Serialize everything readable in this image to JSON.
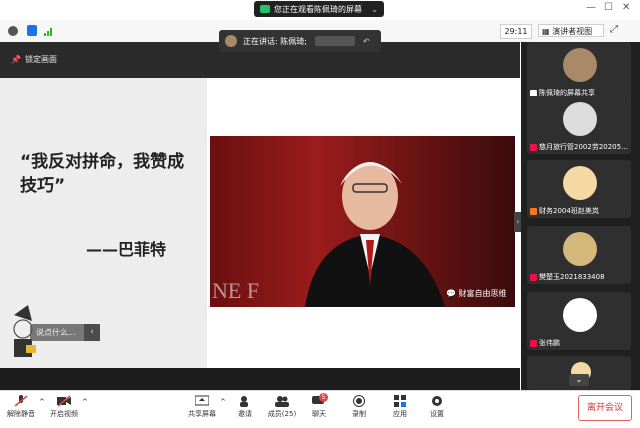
{
  "banner": {
    "text": "您正在观看陈佩琦的屏幕"
  },
  "toolbar": {
    "timer": "29:11",
    "view_label": "演讲者视图"
  },
  "speaker": {
    "label": "正在讲话: 陈佩琦;"
  },
  "stage": {
    "lock_label": "锁定画面",
    "quote": "“我反对拼命，我赞成技巧”",
    "author": "——巴菲特",
    "watermark": "财富自由思维",
    "photo_letters": "NE F",
    "chat_placeholder": "说点什么..."
  },
  "participants": [
    {
      "name": "陈佩琦的屏幕共享",
      "avatar_color": "#a88a68"
    },
    {
      "name": "慈月旅行管2002劳20205...",
      "avatar_color": "#dcdcdc"
    },
    {
      "name": "财务2004班赵美岚",
      "avatar_color": "#f4d9a4"
    },
    {
      "name": "樊楚玉2021833408",
      "avatar_color": "#d4b77a"
    },
    {
      "name": "张伟鹏",
      "avatar_color": "#ffffff"
    }
  ],
  "bottom": {
    "mute": "解除静音",
    "video": "开启视频",
    "share": "共享屏幕",
    "invite": "邀请",
    "members": "成员(25)",
    "chat": "聊天",
    "chat_badge": "5",
    "record": "录制",
    "apps": "应用",
    "settings": "设置",
    "leave": "离开会议"
  },
  "colors": {
    "accent": "#1a73e8",
    "danger": "#e14242",
    "stage_bg": "#1c1c1c"
  }
}
